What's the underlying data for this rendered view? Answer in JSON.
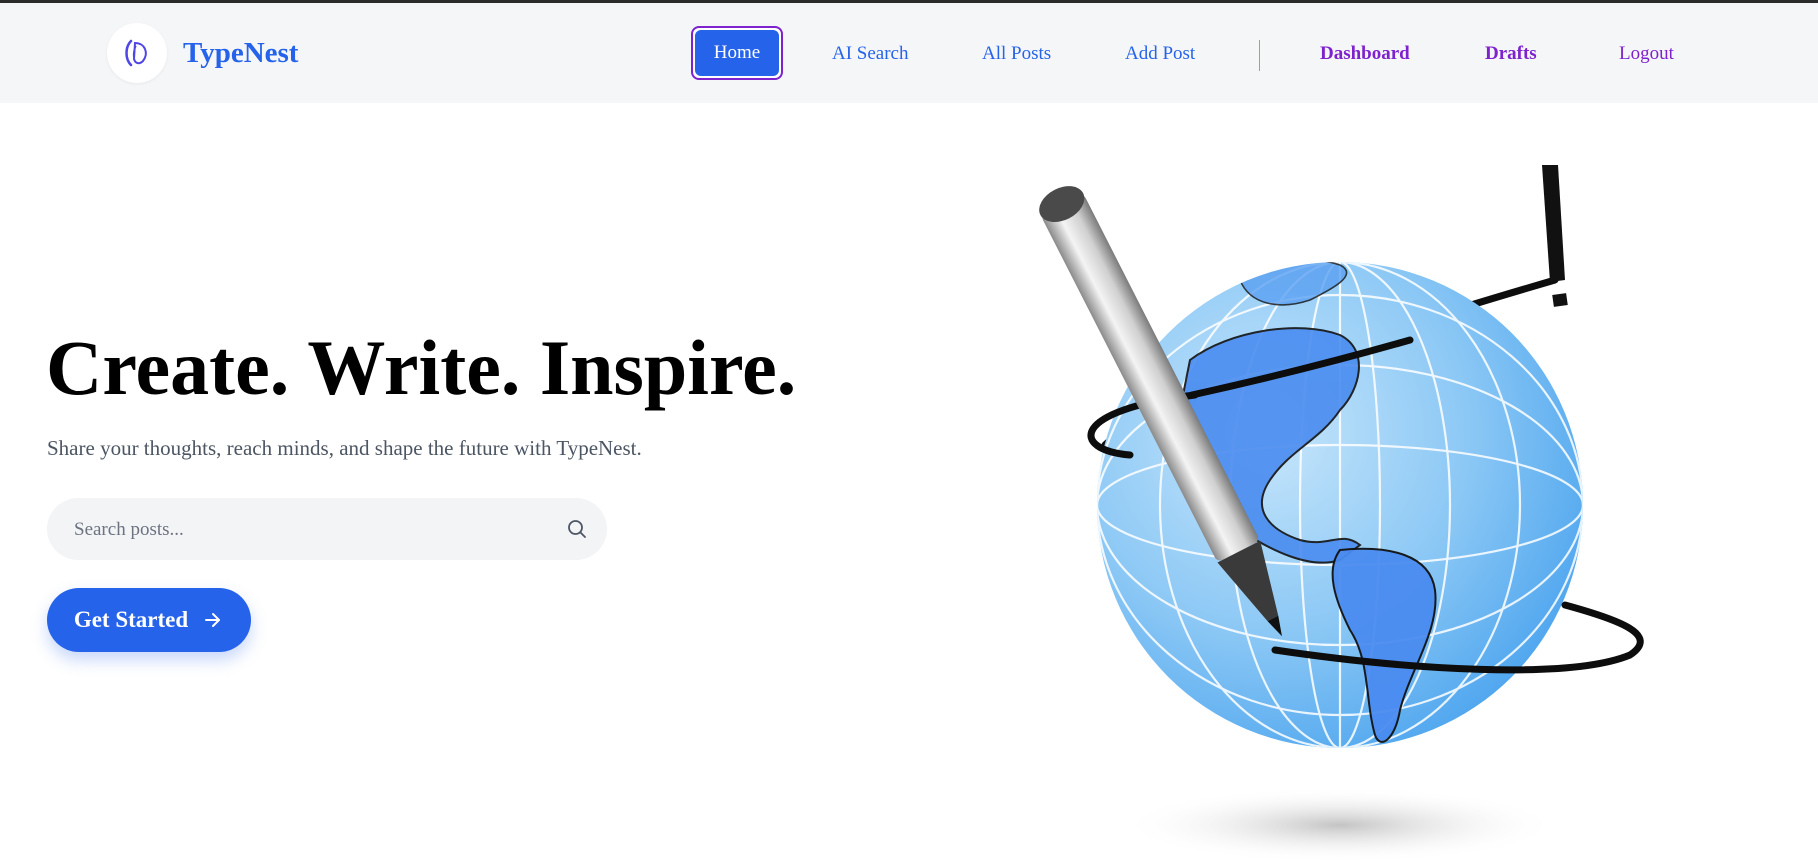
{
  "brand": {
    "name": "TypeNest",
    "logo_icon": "feather-logo-icon"
  },
  "nav": {
    "home": "Home",
    "ai_search": "AI Search",
    "all_posts": "All Posts",
    "add_post": "Add Post",
    "dashboard": "Dashboard",
    "drafts": "Drafts",
    "logout": "Logout"
  },
  "hero": {
    "title": "Create. Write. Inspire.",
    "subtitle": "Share your thoughts, reach minds, and shape the future with TypeNest.",
    "search_placeholder": "Search posts...",
    "search_icon": "search-icon",
    "cta_label": "Get Started",
    "cta_icon": "arrow-right-icon",
    "illustration": "globe-with-pen-illustration"
  },
  "colors": {
    "primary": "#2563eb",
    "accent_purple": "#7e22ce",
    "navbar_bg": "#f5f6f8",
    "text_dark": "#000000",
    "text_muted": "#4b5563"
  }
}
